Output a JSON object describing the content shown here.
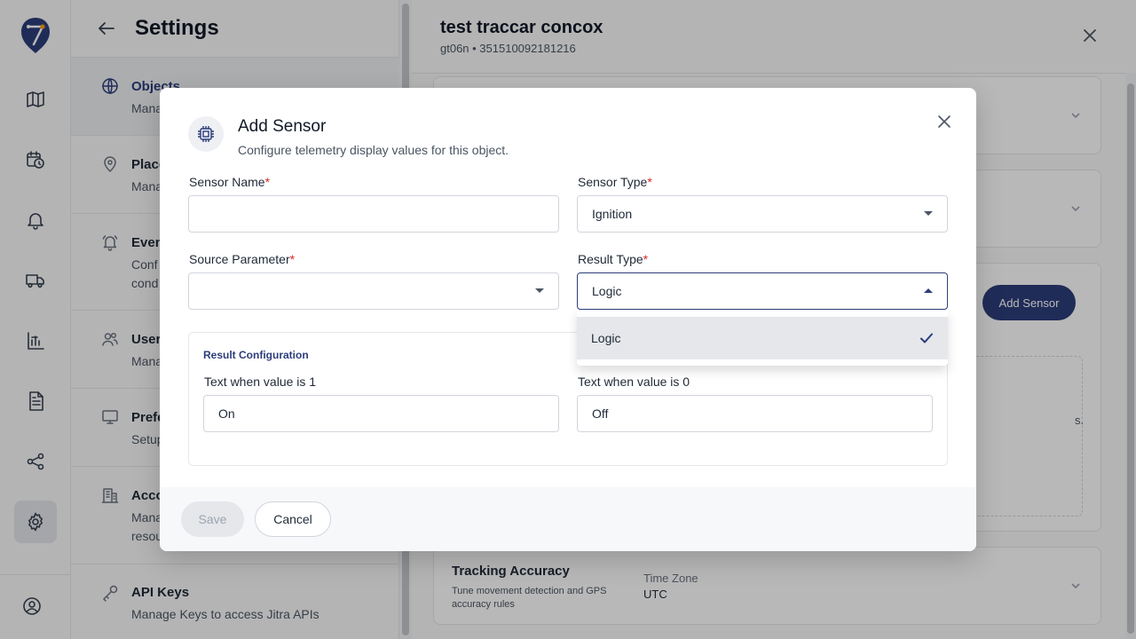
{
  "settings": {
    "title": "Settings",
    "items": [
      {
        "title": "Objects",
        "desc": "Mana"
      },
      {
        "title": "Place",
        "desc": "Mana"
      },
      {
        "title": "Even",
        "desc": "Conf\ncond"
      },
      {
        "title": "User",
        "desc": "Mana"
      },
      {
        "title": "Prefe",
        "desc": "Setup"
      },
      {
        "title": "Acco",
        "desc": "Mana\nresou"
      },
      {
        "title": "API Keys",
        "desc": "Manage Keys to access Jitra APIs"
      }
    ]
  },
  "detail": {
    "title": "test traccar concox",
    "subtitle": "gt06n • 351510092181216",
    "add_sensor_label": "Add Sensor",
    "partial_text": "s.",
    "tracking_accuracy": {
      "title": "Tracking Accuracy",
      "desc": "Tune movement detection and GPS accuracy rules",
      "tz_label": "Time Zone",
      "tz_value": "UTC"
    }
  },
  "modal": {
    "title": "Add Sensor",
    "subtitle": "Configure telemetry display values for this object.",
    "sensor_name": {
      "label": "Sensor Name",
      "required": "*",
      "value": ""
    },
    "sensor_type": {
      "label": "Sensor Type",
      "required": "*",
      "value": "Ignition"
    },
    "source_parameter": {
      "label": "Source Parameter",
      "required": "*",
      "value": ""
    },
    "result_type": {
      "label": "Result Type",
      "required": "*",
      "value": "Logic",
      "options": [
        "Logic"
      ]
    },
    "result_config": {
      "title": "Result Configuration",
      "text1_label": "Text when value is 1",
      "text1_value": "On",
      "text0_label": "Text when value is 0",
      "text0_value": "Off"
    },
    "save_label": "Save",
    "cancel_label": "Cancel"
  },
  "colors": {
    "brand": "#2d3d7a",
    "required": "#dc2626"
  },
  "icons": [
    "logo-icon",
    "map-icon",
    "calendar-clock-icon",
    "bell-icon",
    "truck-icon",
    "bar-chart-icon",
    "document-icon",
    "share-icon",
    "gear-icon",
    "user-circle-icon",
    "arrow-left-icon",
    "globe-icon",
    "map-pin-icon",
    "bell-ring-icon",
    "users-icon",
    "monitor-icon",
    "building-icon",
    "key-icon",
    "close-icon",
    "chip-icon",
    "chevron-down-icon",
    "check-icon"
  ]
}
